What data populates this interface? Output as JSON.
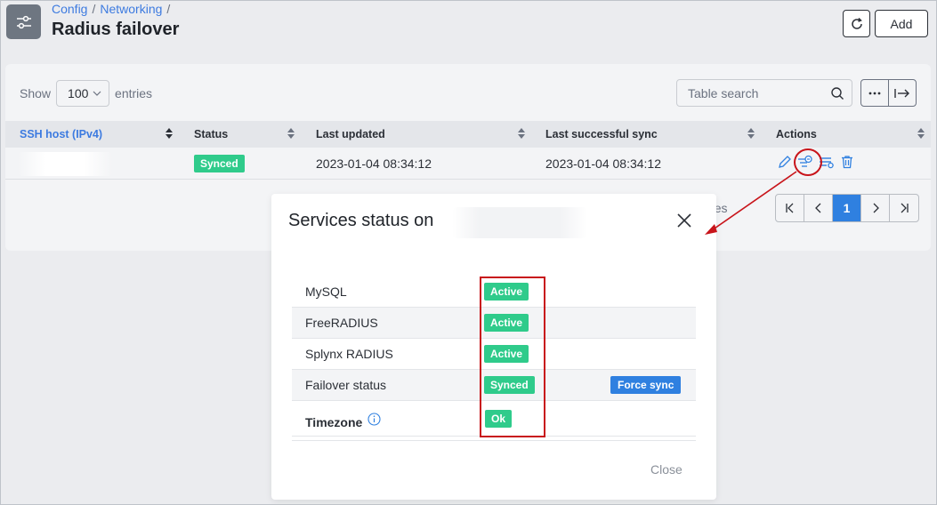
{
  "breadcrumb": {
    "items": [
      "Config",
      "Networking"
    ]
  },
  "page": {
    "title": "Radius failover"
  },
  "header": {
    "add_label": "Add"
  },
  "toolbar": {
    "show_label": "Show",
    "page_size": "100",
    "entries_label": "entries",
    "search_placeholder": "Table search"
  },
  "table": {
    "columns": [
      "SSH host (IPv4)",
      "Status",
      "Last updated",
      "Last successful sync",
      "Actions"
    ],
    "rows": [
      {
        "host": "",
        "status": "Synced",
        "last_updated": "2023-01-04 08:34:12",
        "last_sync": "2023-01-04 08:34:12"
      }
    ]
  },
  "pagination": {
    "current": "1",
    "behind_text": "ries"
  },
  "modal": {
    "title": "Services status on",
    "services": [
      {
        "name": "MySQL",
        "status": "Active"
      },
      {
        "name": "FreeRADIUS",
        "status": "Active"
      },
      {
        "name": "Splynx RADIUS",
        "status": "Active"
      },
      {
        "name": "Failover status",
        "status": "Synced",
        "action": "Force sync"
      },
      {
        "name": "Timezone",
        "status": "Ok"
      }
    ],
    "close_label": "Close"
  },
  "colors": {
    "accent": "#2f80e0",
    "success": "#2fcb8b",
    "annotation": "#c8141a"
  }
}
